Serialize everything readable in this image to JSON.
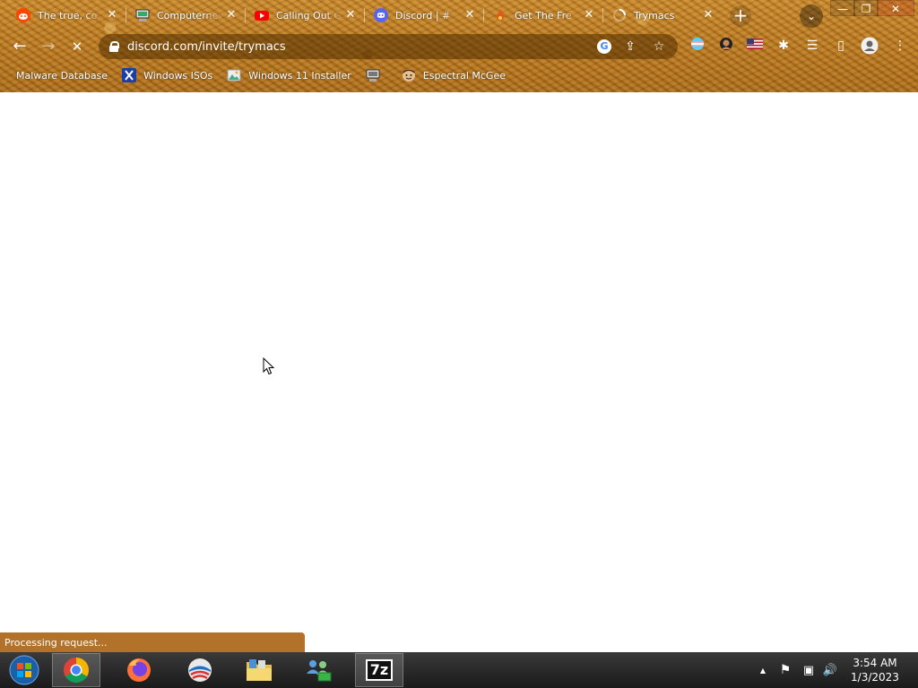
{
  "tabs": [
    {
      "title": "The true, co",
      "favicon": "reddit-icon",
      "color": "#ff4500"
    },
    {
      "title": "Computernew",
      "favicon": "computer-icon",
      "color": "#d0d0d0"
    },
    {
      "title": "Calling Out G",
      "favicon": "youtube-icon",
      "color": "#ff0000"
    },
    {
      "title": "Discord | #",
      "favicon": "discord-icon",
      "color": "#5865f2"
    },
    {
      "title": "Get The Fre",
      "favicon": "fire-icon",
      "color": "#e05a1a"
    },
    {
      "title": "Trymacs",
      "favicon": "loading-spinner-icon",
      "color": "#ffffff"
    }
  ],
  "tab_close_label": "✕",
  "new_tab_label": "+",
  "tab_search_label": "⌄",
  "window_controls": {
    "minimize": "—",
    "restore": "❐",
    "close": "✕"
  },
  "toolbar": {
    "back": "←",
    "forward": "→",
    "stop": "✕"
  },
  "omnibox": {
    "url": "discord.com/invite/trymacs",
    "google_icon": "G",
    "share_icon": "⇪",
    "star_icon": "☆"
  },
  "extensions": {
    "puzzle": "✱",
    "reading_list": "☰",
    "side_panel": "▯",
    "menu": "⋮"
  },
  "bookmarks": [
    {
      "label": "Malware Database",
      "icon": "none"
    },
    {
      "label": "Windows ISOs",
      "icon": "x-icon"
    },
    {
      "label": "Windows 11 Installer",
      "icon": "image-icon"
    },
    {
      "label": "",
      "icon": "computer-icon"
    },
    {
      "label": "Espectral McGee",
      "icon": "face-icon"
    }
  ],
  "status_text": "Processing request...",
  "taskbar": {
    "apps": [
      "start-orb",
      "chrome",
      "firefox",
      "opera",
      "file-explorer",
      "network-app",
      "7zip"
    ],
    "sevenzip_label": "7z"
  },
  "tray": {
    "overflow": "▲",
    "flag": "⚑",
    "network": "▣",
    "volume": "🔊"
  },
  "clock": {
    "time": "3:54 AM",
    "date": "1/3/2023"
  }
}
